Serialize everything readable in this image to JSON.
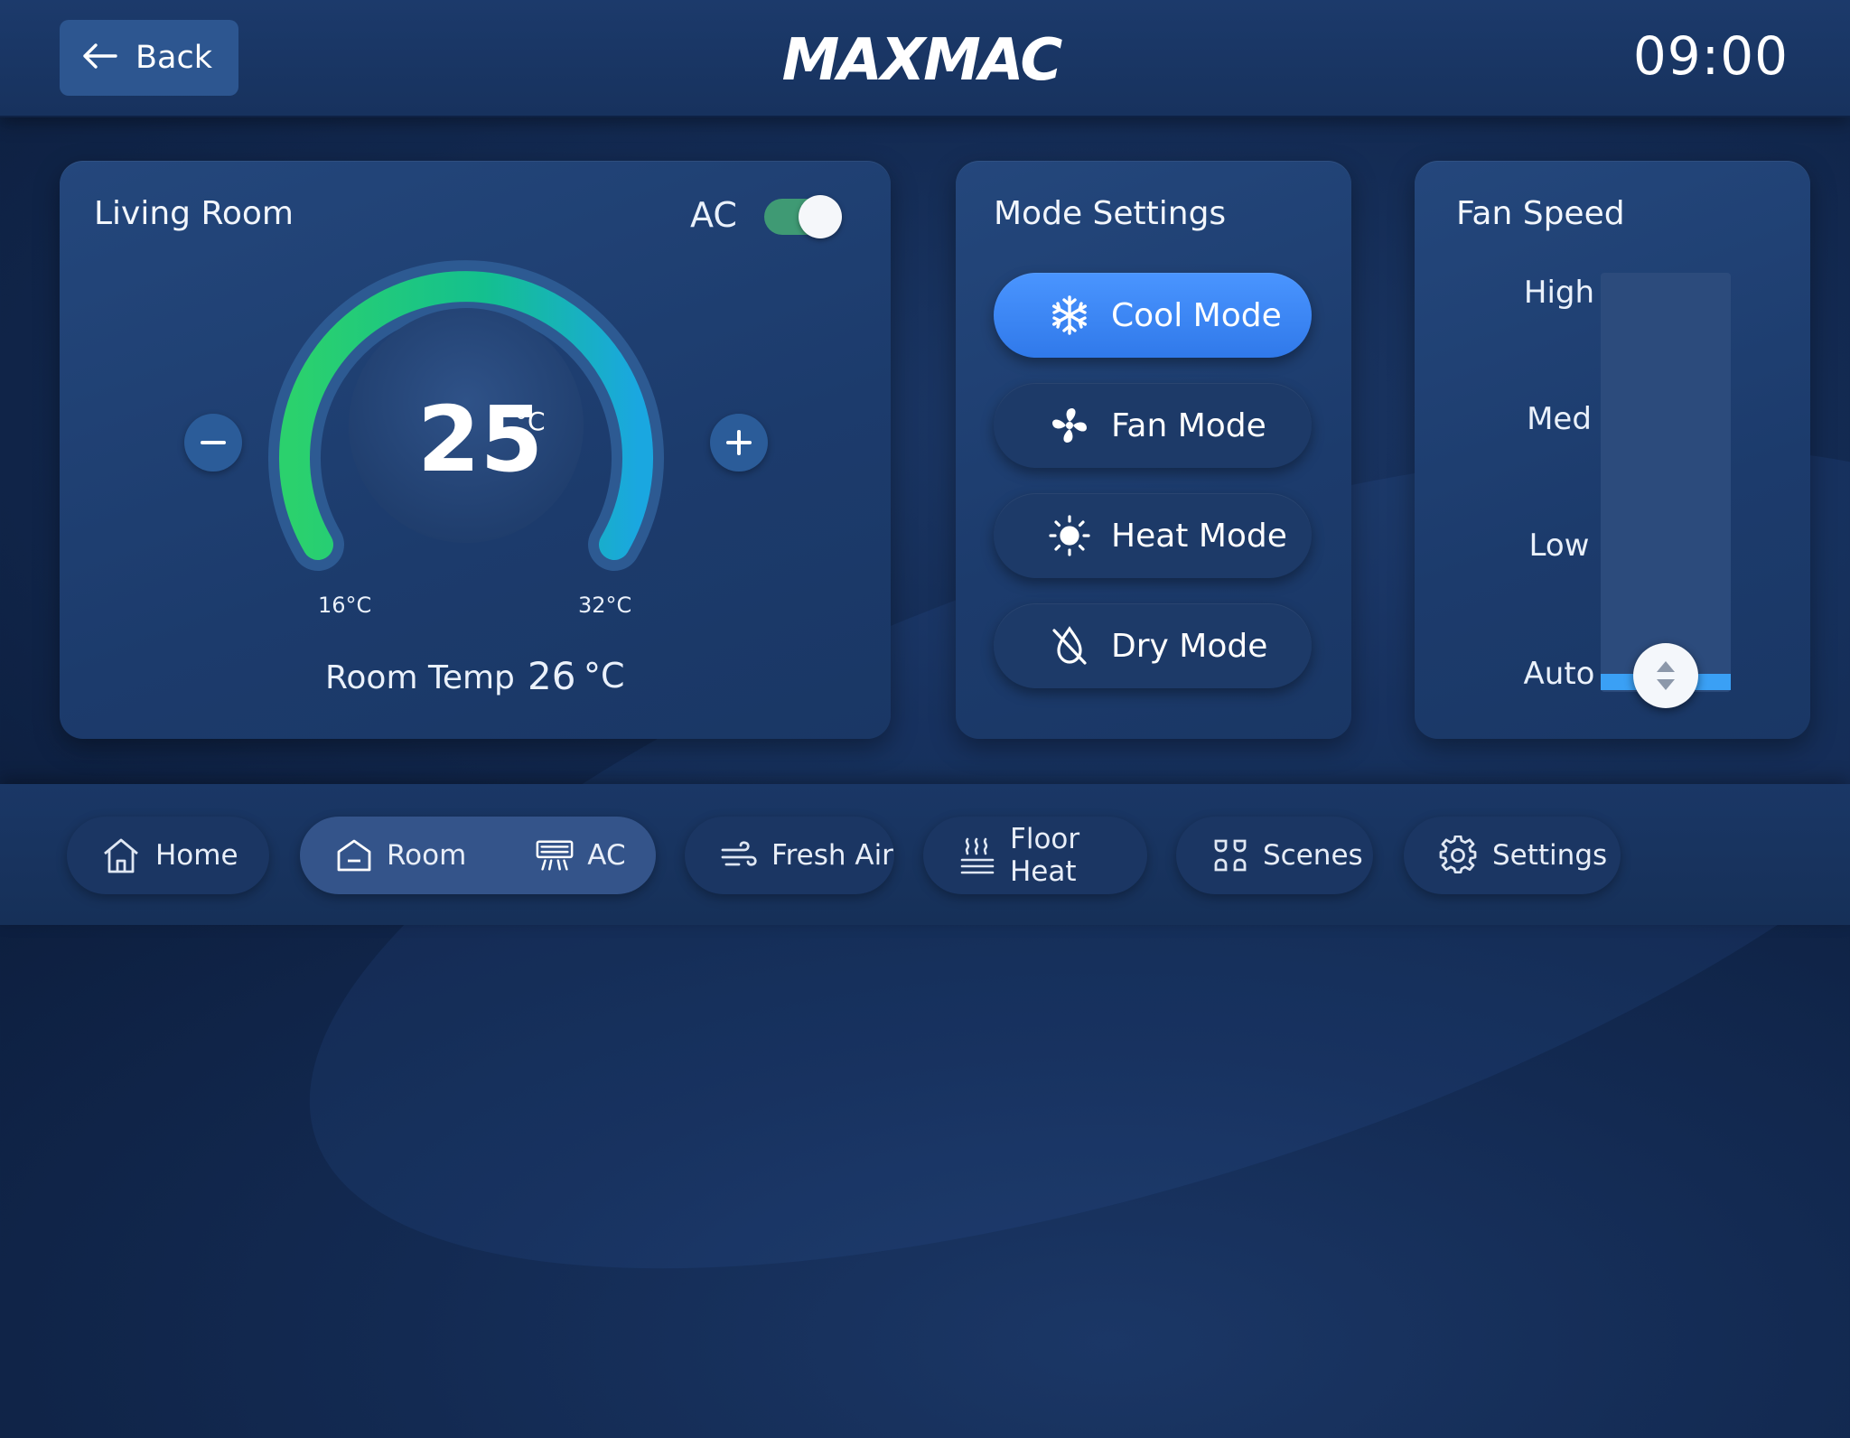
{
  "header": {
    "back_label": "Back",
    "brand": "MAXMAC",
    "time": "09:00"
  },
  "room": {
    "title": "Living Room",
    "ac_label": "AC",
    "ac_on": true,
    "set_temp": "25",
    "temp_unit": "°C",
    "min_temp": "16°C",
    "max_temp": "32°C",
    "room_temp_label": "Room Temp",
    "room_temp_value": "26",
    "room_temp_unit": "°C"
  },
  "modes": {
    "title": "Mode Settings",
    "items": [
      {
        "label": "Cool Mode",
        "icon": "snowflake-icon",
        "active": true
      },
      {
        "label": "Fan Mode",
        "icon": "fan-icon",
        "active": false
      },
      {
        "label": "Heat Mode",
        "icon": "sun-icon",
        "active": false
      },
      {
        "label": "Dry Mode",
        "icon": "dry-drop-icon",
        "active": false
      }
    ]
  },
  "fan": {
    "title": "Fan Speed",
    "levels": [
      "High",
      "Med",
      "Low",
      "Auto"
    ],
    "selected": "Auto"
  },
  "nav": {
    "home": "Home",
    "room": "Room",
    "ac": "AC",
    "fresh_air": "Fresh Air",
    "floor_heat": "Floor Heat",
    "scenes": "Scenes",
    "settings": "Settings",
    "active": "Room"
  },
  "colors": {
    "accent_blue": "#3aa0f5",
    "toggle_green": "#3f9a74",
    "gauge_start": "#2bd16d",
    "gauge_end": "#1aa7e0"
  }
}
